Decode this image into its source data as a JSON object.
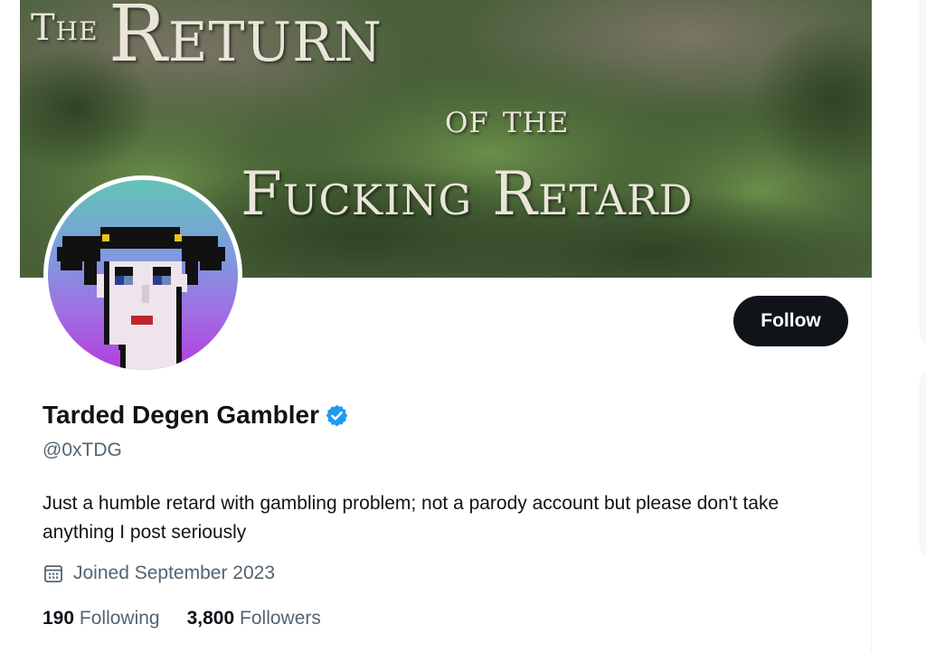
{
  "banner": {
    "line1_small": "The",
    "line1_big": "Return",
    "line2": "of the",
    "line3": "Fucking Retard"
  },
  "profile": {
    "display_name": "Tarded Degen Gambler",
    "verified_icon": "verified-badge-icon",
    "handle": "@0xTDG",
    "bio": "Just a humble retard with gambling problem; not a parody account but please don't take anything I post seriously",
    "joined_icon": "calendar-icon",
    "joined": "Joined September 2023"
  },
  "actions": {
    "follow_label": "Follow"
  },
  "stats": {
    "following_count": "190",
    "following_label": "Following",
    "followers_count": "3,800",
    "followers_label": "Followers"
  },
  "colors": {
    "follow_button_bg": "#0f1419",
    "verified_blue": "#1d9bf0",
    "secondary_text": "#536471",
    "primary_text": "#0f1419"
  }
}
